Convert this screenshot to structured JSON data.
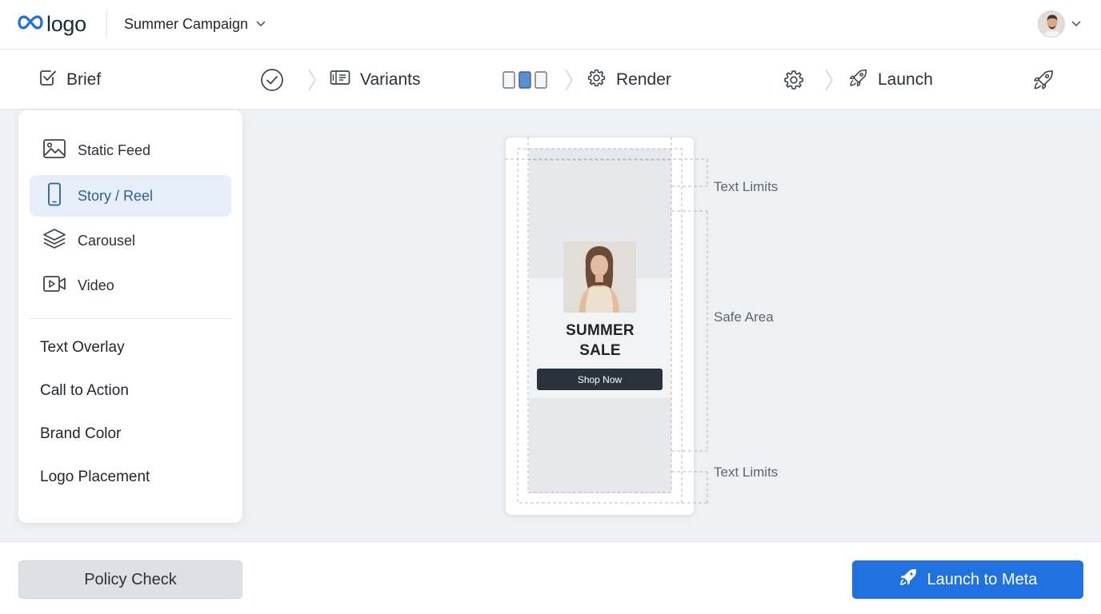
{
  "header": {
    "logo_text": "logo",
    "campaign_name": "Summer Campaign"
  },
  "stepper": {
    "steps": [
      {
        "label": "Brief",
        "status": "complete"
      },
      {
        "label": "Variants",
        "status": "in-progress"
      },
      {
        "label": "Render",
        "status": "pending"
      },
      {
        "label": "Launch",
        "status": "pending"
      }
    ]
  },
  "sidebar": {
    "formats": [
      {
        "label": "Static Feed",
        "icon": "image-icon"
      },
      {
        "label": "Story / Reel",
        "icon": "phone-icon",
        "selected": true
      },
      {
        "label": "Carousel",
        "icon": "layers-icon"
      },
      {
        "label": "Video",
        "icon": "video-icon"
      }
    ],
    "options": [
      {
        "label": "Text Overlay"
      },
      {
        "label": "Call to Action"
      },
      {
        "label": "Brand Color"
      },
      {
        "label": "Logo Placement"
      }
    ]
  },
  "preview": {
    "headline_line1": "SUMMER",
    "headline_line2": "SALE",
    "cta_label": "Shop Now",
    "annotations": {
      "top": "Text Limits",
      "middle": "Safe Area",
      "bottom": "Text Limits"
    }
  },
  "footer": {
    "policy_label": "Policy Check",
    "launch_label": "Launch to Meta"
  },
  "colors": {
    "accent": "#1f72e0",
    "selected_bg": "#e6eefa",
    "selected_text": "#2d5f94",
    "page_bg": "#eef1f4"
  }
}
